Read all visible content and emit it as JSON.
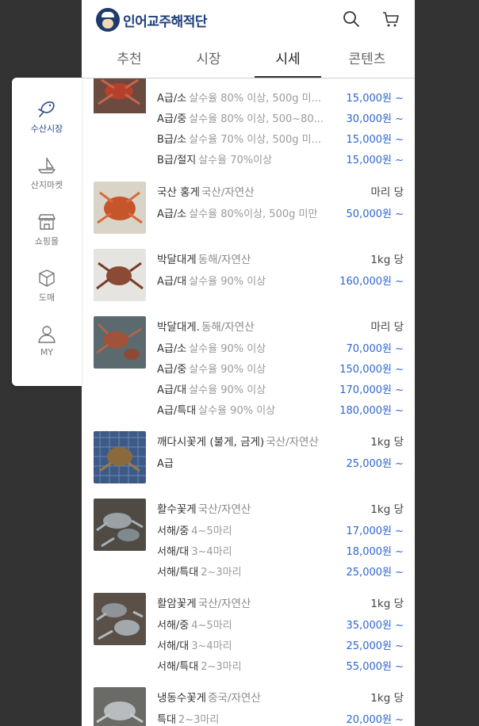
{
  "app": {
    "brand": "인어교주해적단",
    "tabs": [
      {
        "label": "추천"
      },
      {
        "label": "시장"
      },
      {
        "label": "시세",
        "active": true
      },
      {
        "label": "콘텐츠"
      }
    ],
    "icons": {
      "search": "search-icon",
      "cart": "cart-icon"
    }
  },
  "sidebar": {
    "items": [
      {
        "label": "수산시장",
        "icon": "fish-icon",
        "active": true
      },
      {
        "label": "산지마켓",
        "icon": "boat-icon"
      },
      {
        "label": "쇼핑몰",
        "icon": "store-icon"
      },
      {
        "label": "도매",
        "icon": "box-icon"
      },
      {
        "label": "MY",
        "icon": "person-icon"
      }
    ]
  },
  "colors": {
    "price": "#2f66d0",
    "brand": "#1d3f78",
    "background": "#333333"
  },
  "products": [
    {
      "name": "",
      "origin": "",
      "unit": "",
      "rows": [
        {
          "grade": "A급/소",
          "cond": "살수율 80% 이상, 500g 미...",
          "price": "15,000원 ~"
        },
        {
          "grade": "A급/중",
          "cond": "살수율 80% 이상, 500~80...",
          "price": "30,000원 ~"
        },
        {
          "grade": "B급/소",
          "cond": "살수율 70% 이상, 500g 미...",
          "price": "15,000원 ~"
        },
        {
          "grade": "B급/절지",
          "cond": "살수율 70%이상",
          "price": "15,000원 ~"
        }
      ]
    },
    {
      "name": "국산 홍게",
      "origin": "국산/자연산",
      "unit": "마리 당",
      "rows": [
        {
          "grade": "A급/소",
          "cond": "살수율 80%이상, 500g 미만",
          "price": "50,000원 ~"
        }
      ]
    },
    {
      "name": "박달대게",
      "origin": "동해/자연산",
      "unit": "1kg 당",
      "rows": [
        {
          "grade": "A급/대",
          "cond": "살수율 90% 이상",
          "price": "160,000원 ~"
        }
      ]
    },
    {
      "name": "박달대게.",
      "origin": "동해/자연산",
      "unit": "마리 당",
      "rows": [
        {
          "grade": "A급/소",
          "cond": "살수율 90% 이상",
          "price": "70,000원 ~"
        },
        {
          "grade": "A급/중",
          "cond": "살수율 90% 이상",
          "price": "150,000원 ~"
        },
        {
          "grade": "A급/대",
          "cond": "살수율 90% 이상",
          "price": "170,000원 ~"
        },
        {
          "grade": "A급/특대",
          "cond": "살수율 90% 이상",
          "price": "180,000원 ~"
        }
      ]
    },
    {
      "name": "깨다시꽃게 (불게, 금게)",
      "origin": "국산/자연산",
      "unit": "1kg 당",
      "rows": [
        {
          "grade": "A급",
          "cond": "",
          "price": "25,000원 ~"
        }
      ]
    },
    {
      "name": "활수꽃게",
      "origin": "국산/자연산",
      "unit": "1kg 당",
      "rows": [
        {
          "grade": "서해/중",
          "cond": "4~5마리",
          "price": "17,000원 ~"
        },
        {
          "grade": "서해/대",
          "cond": "3~4마리",
          "price": "18,000원 ~"
        },
        {
          "grade": "서해/특대",
          "cond": "2~3마리",
          "price": "25,000원 ~"
        }
      ]
    },
    {
      "name": "활암꽃게",
      "origin": "국산/자연산",
      "unit": "1kg 당",
      "rows": [
        {
          "grade": "서해/중",
          "cond": "4~5마리",
          "price": "35,000원 ~"
        },
        {
          "grade": "서해/대",
          "cond": "3~4마리",
          "price": "25,000원 ~"
        },
        {
          "grade": "서해/특대",
          "cond": "2~3마리",
          "price": "55,000원 ~"
        }
      ]
    },
    {
      "name": "냉동수꽃게",
      "origin": "중국/자연산",
      "unit": "1kg 당",
      "rows": [
        {
          "grade": "특대",
          "cond": "2~3마리",
          "price": "20,000원 ~"
        }
      ]
    }
  ]
}
